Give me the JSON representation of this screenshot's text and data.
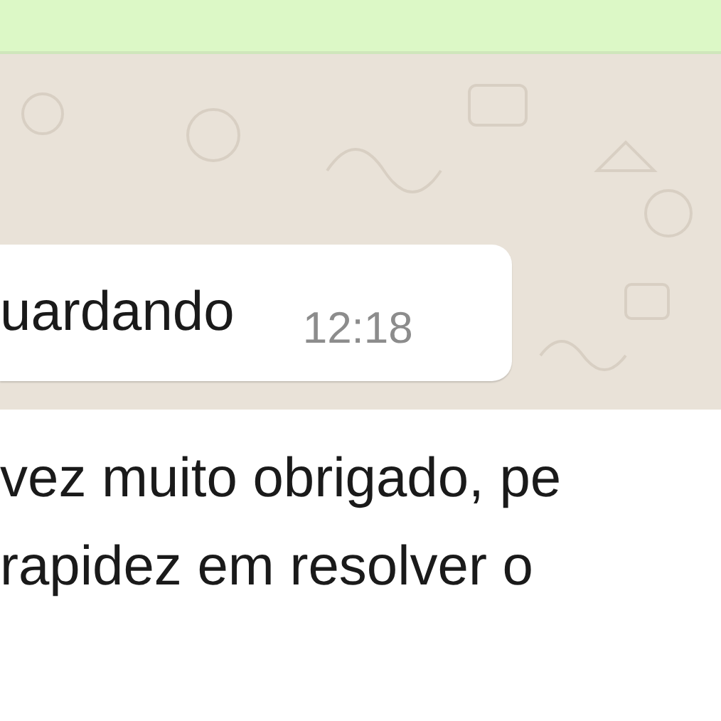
{
  "messages": [
    {
      "kind": "outgoing_edge"
    },
    {
      "kind": "incoming",
      "lines": [
        "uardando"
      ],
      "time": "12:18"
    },
    {
      "kind": "incoming",
      "lines": [
        "vez muito obrigado, pe",
        "rapidez em resolver o"
      ]
    }
  ]
}
